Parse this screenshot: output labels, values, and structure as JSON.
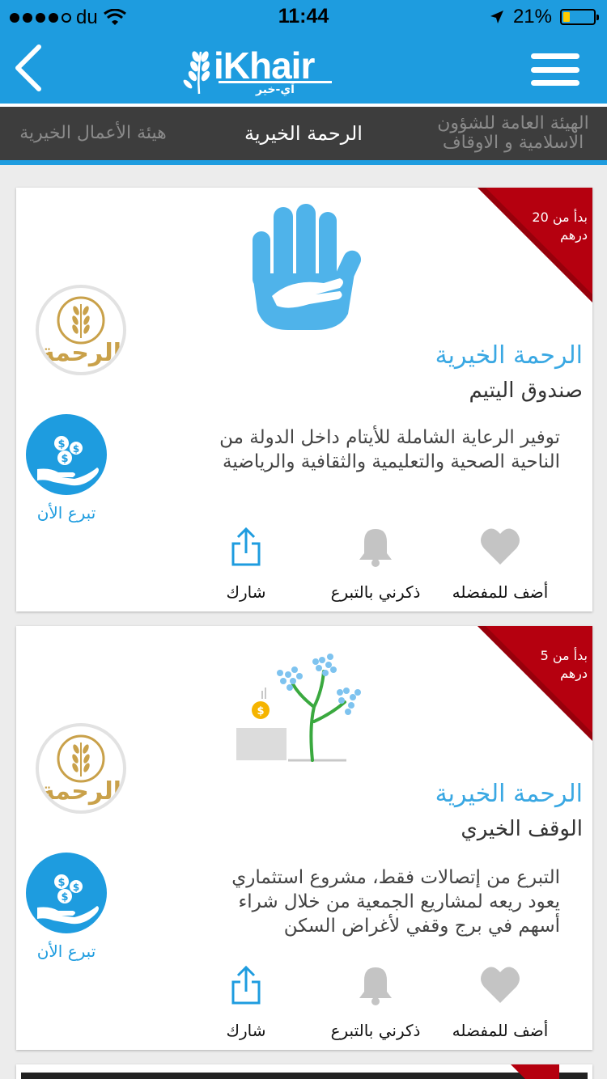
{
  "status_bar": {
    "carrier": "du",
    "time": "11:44",
    "battery_percent": "21%",
    "battery_level": 0.21
  },
  "header": {
    "logo_text": "iKhair",
    "logo_arabic": "آي-خير"
  },
  "tabs": [
    {
      "label": "الهيئة العامة للشؤون الاسلامية و الاوقاف",
      "line1": "الهيئة العامة للشؤون",
      "line2": "الاسلامية و الاوقاف"
    },
    {
      "label": "الرحمة الخيرية"
    },
    {
      "label": "هيئة الأعمال الخيرية"
    }
  ],
  "cards": [
    {
      "ribbon_line1": "بدأ من 20",
      "ribbon_line2": "درهم",
      "org": "الرحمة الخيرية",
      "fund": "صندوق اليتيم",
      "description": "توفير الرعاية الشاملة للأيتام داخل الدولة من الناحية الصحية والتعليمية والثقافية والرياضية",
      "donate_label": "تبرع الأن",
      "actions": {
        "favorite": "أضف للمفضله",
        "remind": "ذكرني بالتبرع",
        "share": "شارك"
      }
    },
    {
      "ribbon_line1": "بدأ من 5",
      "ribbon_line2": "درهم",
      "org": "الرحمة الخيرية",
      "fund": "الوقف الخيري",
      "description": "التبرع من إتصالات فقط، مشروع استثماري يعود ريعه لمشاريع الجمعية من خلال شراء أسهم في برج وقفي لأغراض السكن",
      "donate_label": "تبرع الأن",
      "actions": {
        "favorite": "أضف للمفضله",
        "remind": "ذكرني بالتبرع",
        "share": "شارك"
      }
    }
  ],
  "org_logo_text": "الرحمة",
  "colors": {
    "primary": "#1e9cdf",
    "tab_bar": "#3d3d3d",
    "ribbon": "#b5000f",
    "org_name": "#3aa8e3",
    "hand_icon": "#4fb3ea",
    "gold": "#c9a14a",
    "inactive_icon": "#c4c4c4"
  },
  "icons": [
    "signal-dots",
    "wifi-icon",
    "location-arrow-icon",
    "battery-icon",
    "back-chevron-icon",
    "menu-icon",
    "hand-icon",
    "tree-icon",
    "coins-hand-icon",
    "heart-icon",
    "bell-icon",
    "share-icon"
  ]
}
